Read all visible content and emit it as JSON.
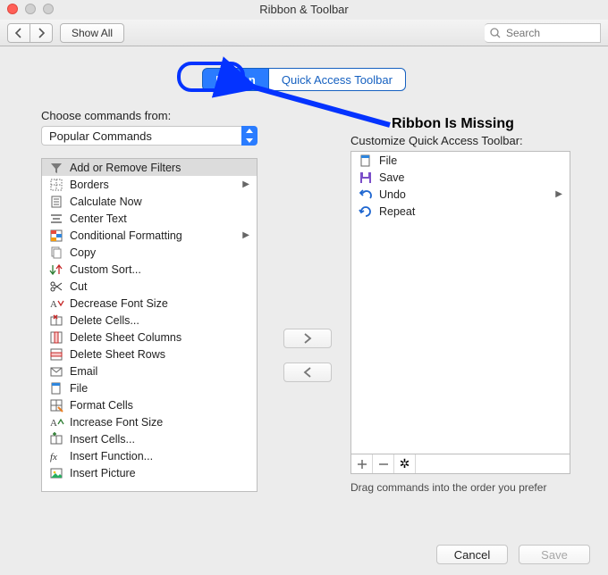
{
  "window": {
    "title": "Ribbon & Toolbar"
  },
  "toolbar": {
    "show_all": "Show All",
    "search_placeholder": "Search"
  },
  "tabs": {
    "ribbon": "Ribbon",
    "qat": "Quick Access Toolbar"
  },
  "annotation": {
    "text": "Ribbon Is Missing"
  },
  "left": {
    "choose_label": "Choose commands from:",
    "combo_value": "Popular Commands",
    "items": [
      {
        "icon": "funnel-icon",
        "label": "Add or Remove Filters",
        "submenu": false,
        "selected": true
      },
      {
        "icon": "borders-icon",
        "label": "Borders",
        "submenu": true
      },
      {
        "icon": "calc-icon",
        "label": "Calculate Now",
        "submenu": false
      },
      {
        "icon": "center-icon",
        "label": "Center Text",
        "submenu": false
      },
      {
        "icon": "cond-format-icon",
        "label": "Conditional Formatting",
        "submenu": true
      },
      {
        "icon": "copy-icon",
        "label": "Copy",
        "submenu": false
      },
      {
        "icon": "sort-icon",
        "label": "Custom Sort...",
        "submenu": false
      },
      {
        "icon": "scissors-icon",
        "label": "Cut",
        "submenu": false
      },
      {
        "icon": "font-decrease-icon",
        "label": "Decrease Font Size",
        "submenu": false
      },
      {
        "icon": "delete-cells-icon",
        "label": "Delete Cells...",
        "submenu": false
      },
      {
        "icon": "delete-cols-icon",
        "label": "Delete Sheet Columns",
        "submenu": false
      },
      {
        "icon": "delete-rows-icon",
        "label": "Delete Sheet Rows",
        "submenu": false
      },
      {
        "icon": "email-icon",
        "label": "Email",
        "submenu": false
      },
      {
        "icon": "file-icon",
        "label": "File",
        "submenu": false
      },
      {
        "icon": "format-cells-icon",
        "label": "Format Cells",
        "submenu": false
      },
      {
        "icon": "font-increase-icon",
        "label": "Increase Font Size",
        "submenu": false
      },
      {
        "icon": "insert-cells-icon",
        "label": "Insert Cells...",
        "submenu": false
      },
      {
        "icon": "fx-icon",
        "label": "Insert Function...",
        "submenu": false
      },
      {
        "icon": "picture-icon",
        "label": "Insert Picture",
        "submenu": false
      }
    ]
  },
  "right": {
    "label": "Customize Quick Access Toolbar:",
    "items": [
      {
        "icon": "file-icon",
        "label": "File",
        "submenu": false
      },
      {
        "icon": "save-icon",
        "label": "Save",
        "submenu": false
      },
      {
        "icon": "undo-icon",
        "label": "Undo",
        "submenu": true
      },
      {
        "icon": "repeat-icon",
        "label": "Repeat",
        "submenu": false
      }
    ],
    "hint": "Drag commands into the order you prefer"
  },
  "footer": {
    "cancel": "Cancel",
    "save": "Save"
  }
}
